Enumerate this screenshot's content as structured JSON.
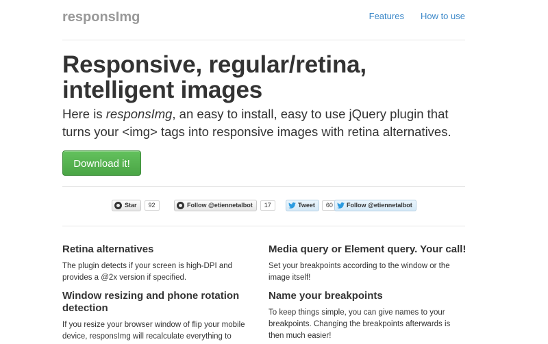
{
  "header": {
    "brand": "responsImg",
    "nav": [
      {
        "label": "Features"
      },
      {
        "label": "How to use"
      }
    ]
  },
  "hero": {
    "title": "Responsive, regular/retina, intelligent images",
    "lead_before": "Here is ",
    "lead_em": "responsImg",
    "lead_after": ", an easy to install, easy to use jQuery plugin that turns your <img> tags into responsive images with retina alternatives.",
    "download_label": "Download it!"
  },
  "social": {
    "github_star_label": "Star",
    "github_star_count": "92",
    "github_follow_label": "Follow @etiennetalbot",
    "github_follow_count": "17",
    "tweet_label": "Tweet",
    "tweet_count": "60",
    "twitter_follow_label": "Follow @etiennetalbot"
  },
  "features": {
    "left": [
      {
        "title": "Retina alternatives",
        "text": "The plugin detects if your screen is high-DPI and provides a @2x version if specified."
      },
      {
        "title": "Window resizing and phone rotation detection",
        "text": "If you resize your browser window of flip your mobile device, responsImg will recalculate everything to"
      }
    ],
    "right": [
      {
        "title": "Media query or Element query. Your call!",
        "text": "Set your breakpoints according to the window or the image itself!"
      },
      {
        "title": "Name your breakpoints",
        "text": "To keep things simple, you can give names to your breakpoints. Changing the breakpoints afterwards is then much easier!"
      }
    ]
  },
  "colors": {
    "link": "#3a87c8",
    "download_button": "#5cb85c",
    "brand": "#999999"
  }
}
